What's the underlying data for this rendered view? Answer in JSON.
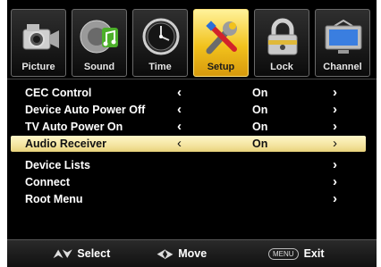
{
  "tabs": [
    {
      "label": "Picture",
      "icon": "camera-icon",
      "active": false
    },
    {
      "label": "Sound",
      "icon": "music-note-icon",
      "active": false
    },
    {
      "label": "Time",
      "icon": "clock-icon",
      "active": false
    },
    {
      "label": "Setup",
      "icon": "tools-icon",
      "active": true
    },
    {
      "label": "Lock",
      "icon": "padlock-icon",
      "active": false
    },
    {
      "label": "Channel",
      "icon": "monitor-icon",
      "active": false
    }
  ],
  "menu": {
    "items": [
      {
        "name": "CEC Control",
        "value": "On",
        "left_arrow": "‹",
        "right_arrow": "›"
      },
      {
        "name": "Device Auto Power Off",
        "value": "On",
        "left_arrow": "‹",
        "right_arrow": "›"
      },
      {
        "name": "TV Auto Power On",
        "value": "On",
        "left_arrow": "‹",
        "right_arrow": "›"
      },
      {
        "name": "Audio Receiver",
        "value": "On",
        "left_arrow": "‹",
        "right_arrow": "›",
        "selected": true
      },
      {
        "name": "Device Lists",
        "value": "",
        "left_arrow": "",
        "right_arrow": "›"
      },
      {
        "name": "Connect",
        "value": "",
        "left_arrow": "",
        "right_arrow": "›"
      },
      {
        "name": "Root Menu",
        "value": "",
        "left_arrow": "",
        "right_arrow": "›"
      }
    ]
  },
  "footer": {
    "select_glyph": "⮝⮟",
    "select_label": "Select",
    "move_glyph": "⮜⮞",
    "move_label": "Move",
    "menu_key": "MENU",
    "exit_label": "Exit"
  },
  "colors": {
    "active_tab": "#f2c21d",
    "selection": "#f4e4a0",
    "background": "#000000"
  }
}
